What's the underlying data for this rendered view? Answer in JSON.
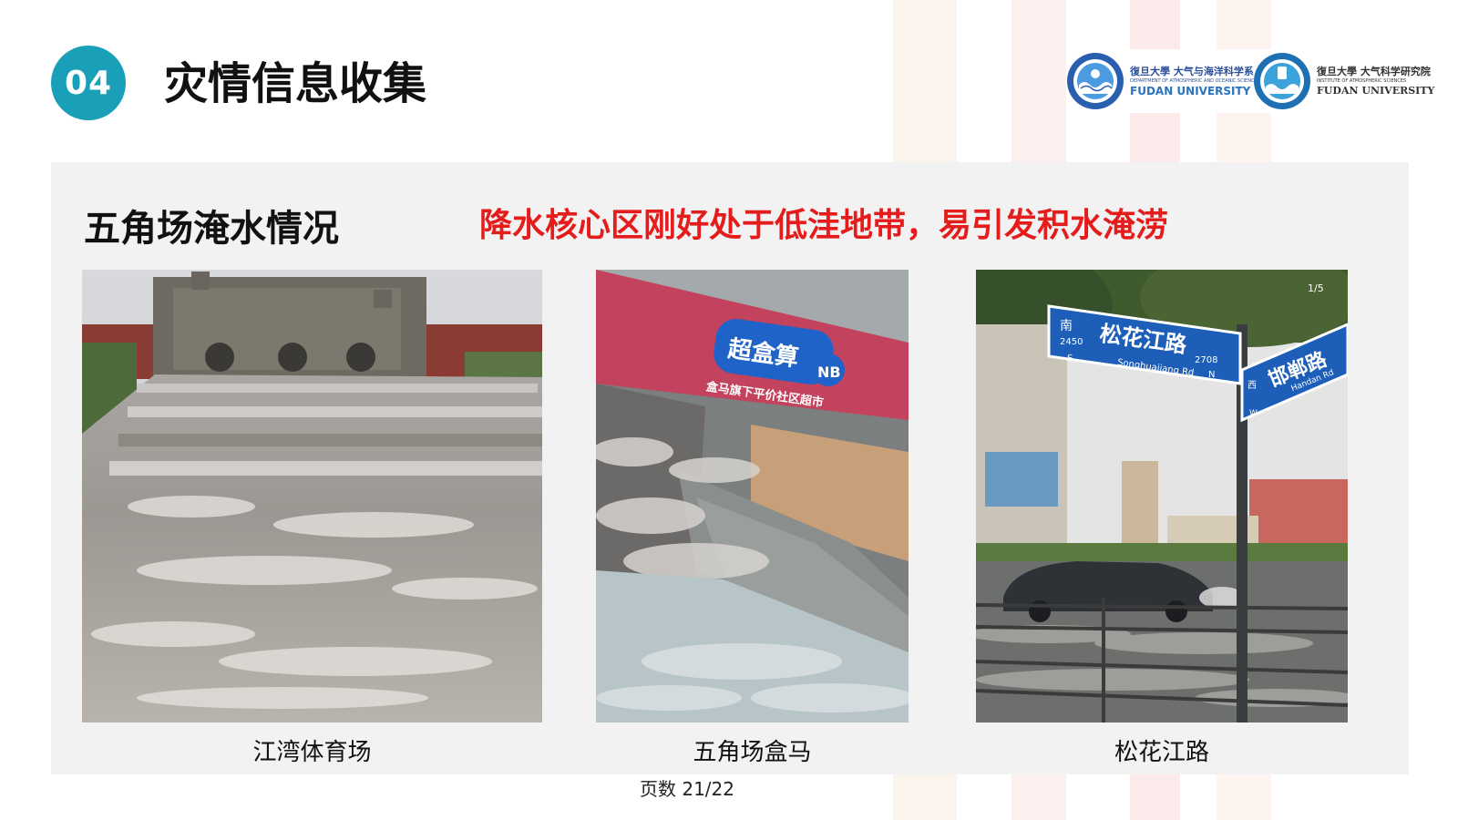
{
  "header": {
    "section_number": "04",
    "title": "灾情信息收集"
  },
  "logos": [
    {
      "cn": "復旦大學 大气与海洋科学系",
      "en_small": "DEPARTMENT OF ATMOSPHERIC AND OCEANIC SCIENCES",
      "en": "FUDAN UNIVERSITY"
    },
    {
      "cn": "復旦大學 大气科学研究院",
      "en_small": "INSTITUTE OF ATMOSPHERIC SCIENCES",
      "en": "FUDAN UNIVERSITY"
    }
  ],
  "section": {
    "title": "五角场淹水情况",
    "highlight": "降水核心区刚好处于低洼地带，易引发积水淹涝"
  },
  "photos": [
    {
      "caption": "江湾体育场"
    },
    {
      "caption": "五角场盒马",
      "sign_brand": "超盒算",
      "sign_badge": "NB",
      "sign_sub": "盒马旗下平价社区超市"
    },
    {
      "caption": "松花江路",
      "sign_cn": "松花江路",
      "sign_pinyin": "Songhuajiang Rd",
      "sign_dir": "南",
      "sign_num_left": "2450",
      "sign_num_right": "2708",
      "sign_s": "S",
      "sign_n": "N",
      "sign2_cn": "邯郸路",
      "sign2_pinyin": "Handan Rd",
      "sign2_dir": "西",
      "sign2_w": "W",
      "counter": "1/5"
    }
  ],
  "footer": {
    "page": "页数 21/22"
  },
  "colors": {
    "accent": "#1a9fb8",
    "highlight": "#e51c1c",
    "panel": "#f2f2f2"
  }
}
